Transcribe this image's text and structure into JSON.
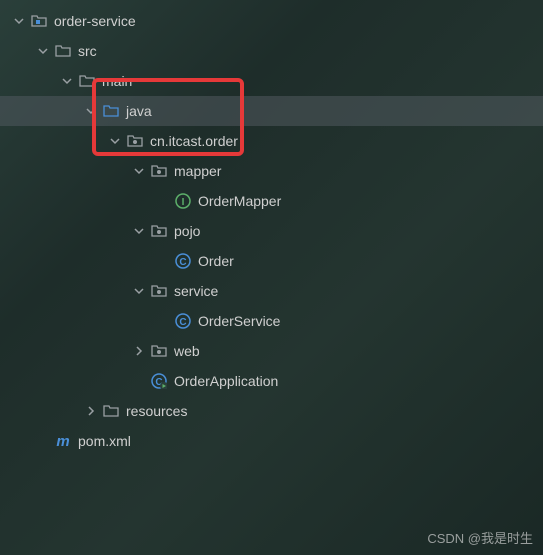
{
  "tree": {
    "order_service": "order-service",
    "src": "src",
    "main": "main",
    "java": "java",
    "pkg": "cn.itcast.order",
    "mapper": "mapper",
    "order_mapper": "OrderMapper",
    "pojo": "pojo",
    "order": "Order",
    "service": "service",
    "order_service_class": "OrderService",
    "web": "web",
    "order_application": "OrderApplication",
    "resources": "resources",
    "pom": "pom.xml"
  },
  "watermark": "CSDN @我是时生"
}
